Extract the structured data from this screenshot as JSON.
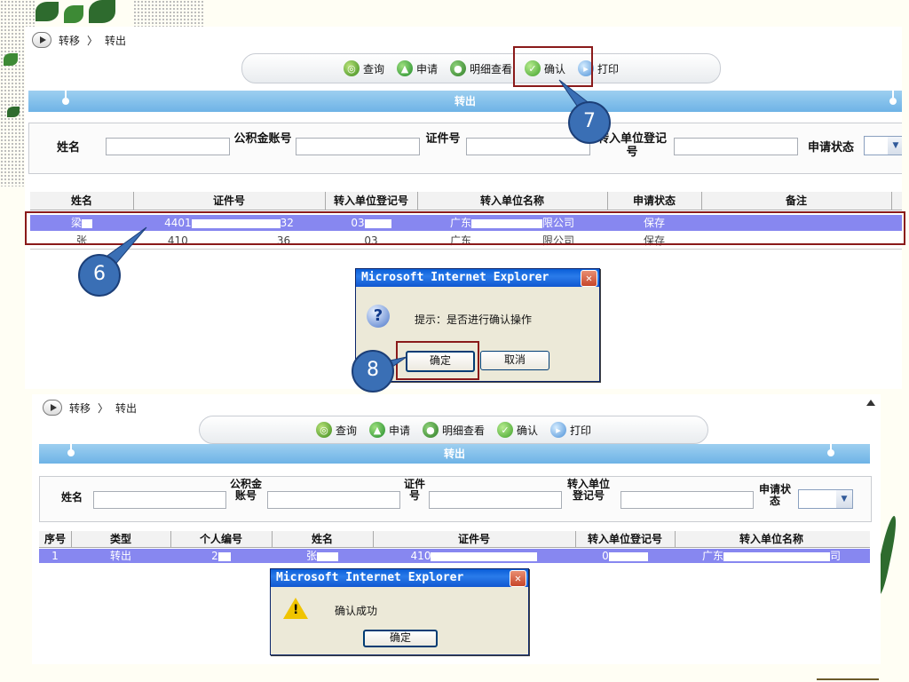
{
  "top": {
    "breadcrumb": {
      "module": "转移",
      "sep": "〉",
      "page": "转出"
    },
    "toolbar": {
      "query": "查询",
      "apply": "申请",
      "detail": "明细查看",
      "confirm": "确认",
      "print": "打印"
    },
    "section_title": "转出",
    "filters": {
      "name": "姓名",
      "fund_account": "公积金账号",
      "id_no": "证件号",
      "dest_unit_reg": "转入单位登记号",
      "status": "申请状态"
    },
    "table": {
      "headers": [
        "姓名",
        "证件号",
        "转入单位登记号",
        "转入单位名称",
        "申请状态",
        "备注"
      ],
      "rows": [
        {
          "name": "梁",
          "id": "4401",
          "id_tail": "32",
          "reg": "03",
          "unit": "广东",
          "unit_tail": "限公司",
          "status": "保存",
          "note": ""
        },
        {
          "name": "张",
          "id": "410",
          "id_tail": "36",
          "reg": "03",
          "unit": "广东",
          "unit_tail": "限公司",
          "status": "保存",
          "note": ""
        }
      ]
    },
    "dialog": {
      "title": "Microsoft Internet Explorer",
      "message": "提示：是否进行确认操作",
      "ok": "确定",
      "cancel": "取消"
    }
  },
  "bottom": {
    "breadcrumb": {
      "module": "转移",
      "sep": "〉",
      "page": "转出"
    },
    "toolbar": {
      "query": "查询",
      "apply": "申请",
      "detail": "明细查看",
      "confirm": "确认",
      "print": "打印"
    },
    "section_title": "转出",
    "filters": {
      "name": "姓名",
      "fund_account": "公积金账号",
      "id_no": "证件号",
      "dest_unit_reg": "转入单位登记号",
      "status": "申请状态"
    },
    "table": {
      "headers": [
        "序号",
        "类型",
        "个人编号",
        "姓名",
        "证件号",
        "转入单位登记号",
        "转入单位名称"
      ],
      "rows": [
        {
          "seq": "1",
          "type": "转出",
          "pid": "2",
          "name": "张",
          "id": "410",
          "reg": "0",
          "unit": "广东",
          "unit_tail": "司"
        }
      ]
    },
    "dialog": {
      "title": "Microsoft Internet Explorer",
      "message": "确认成功",
      "ok": "确定"
    }
  },
  "callouts": {
    "step6": "6",
    "step7": "7",
    "step8": "8"
  },
  "colors": {
    "header_bar": "#6eb3e6",
    "selected_row": "#8787f0",
    "highlight_box": "#8a1a1a",
    "callout": "#3a6fb5"
  }
}
